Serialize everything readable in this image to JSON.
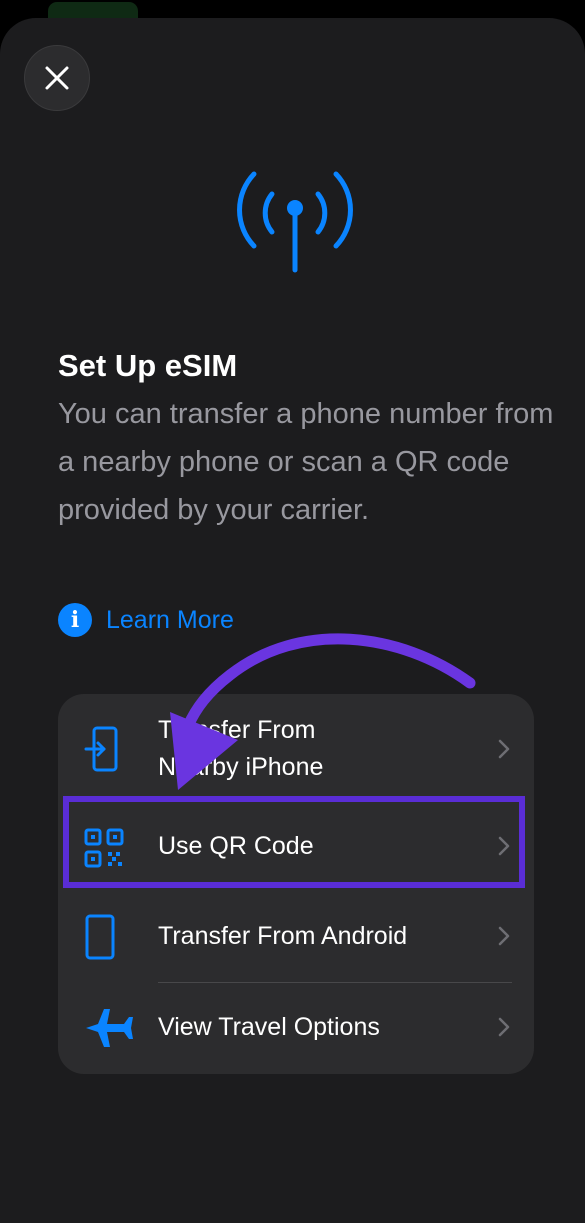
{
  "header": {
    "close_icon": "close-icon"
  },
  "hero": {
    "icon": "antenna-signal-icon"
  },
  "content": {
    "title": "Set Up eSIM",
    "description": "You can transfer a phone number from a nearby phone or scan a QR code provided by your carrier.",
    "learn_more": "Learn More"
  },
  "options": [
    {
      "label_line1": "Transfer From",
      "label_line2": "Nearby iPhone",
      "icon": "transfer-in-icon"
    },
    {
      "label": "Use QR Code",
      "icon": "qr-code-icon"
    },
    {
      "label": "Transfer From Android",
      "icon": "phone-outline-icon"
    },
    {
      "label": "View Travel Options",
      "icon": "airplane-icon"
    }
  ],
  "annotation": {
    "highlight_color": "#5a2dd6",
    "arrow_color": "#6a35e0"
  },
  "colors": {
    "accent": "#0a84ff",
    "background": "#1c1c1e",
    "card": "#2c2c2e"
  }
}
